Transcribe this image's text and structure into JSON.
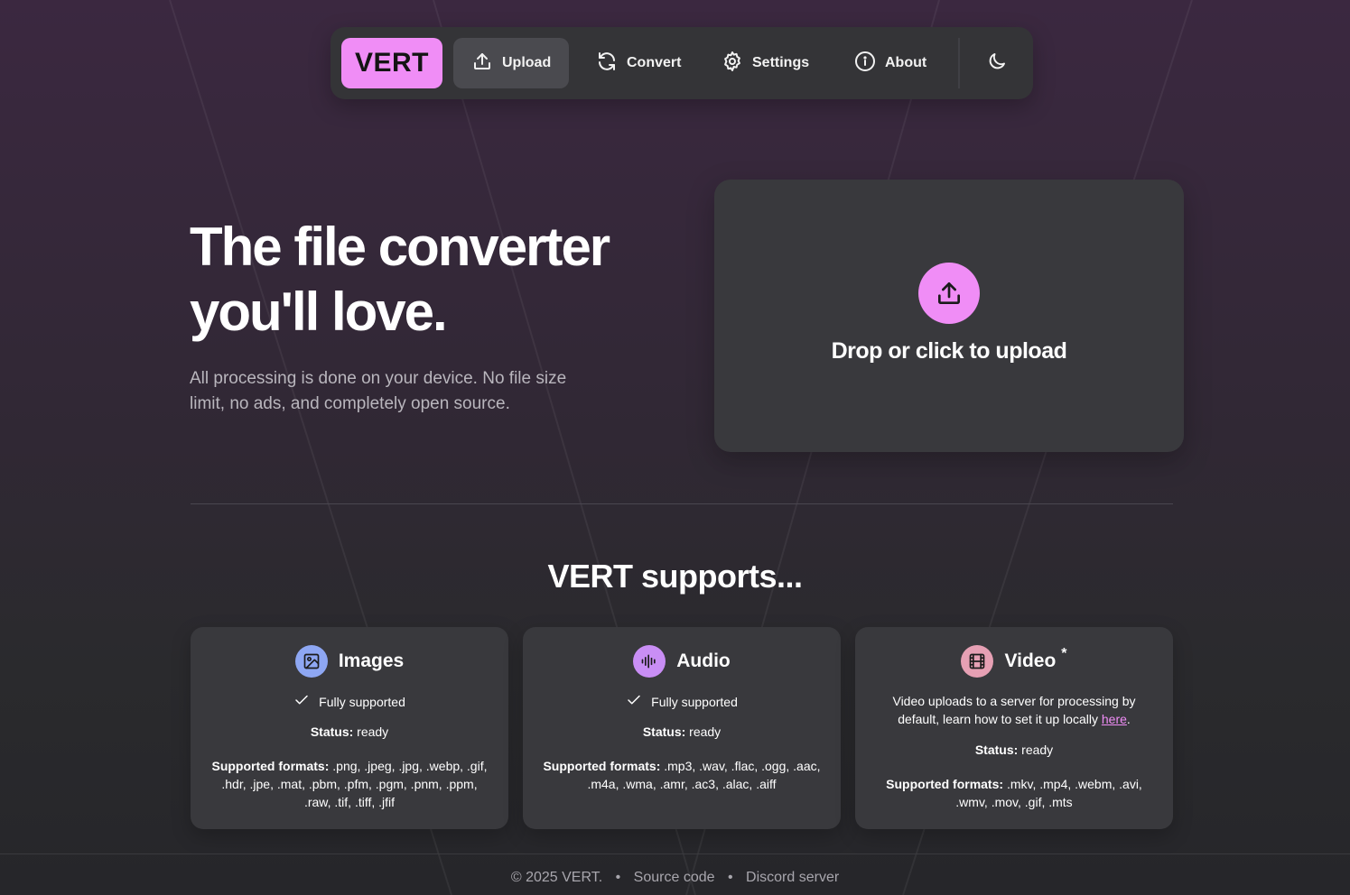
{
  "nav": {
    "logo": "VERT",
    "items": [
      {
        "label": "Upload",
        "icon": "upload-icon"
      },
      {
        "label": "Convert",
        "icon": "refresh-icon"
      },
      {
        "label": "Settings",
        "icon": "gear-icon"
      },
      {
        "label": "About",
        "icon": "info-icon"
      }
    ],
    "theme_icon": "moon-icon"
  },
  "hero": {
    "title_line1": "The file converter",
    "title_line2": "you'll love.",
    "sub_line1": "All processing is done on your device. No file size",
    "sub_line2": "limit, no ads, and completely open source."
  },
  "upload": {
    "label": "Drop or click to upload",
    "icon": "upload-icon"
  },
  "supports": {
    "title": "VERT supports...",
    "cards": [
      {
        "title": "Images",
        "icon": "image-icon",
        "icon_bg": "#8ea7f3",
        "support": "Fully supported",
        "status_label": "Status:",
        "status": "ready",
        "formats_label": "Supported formats:",
        "formats": ".png, .jpeg, .jpg, .webp, .gif, .hdr, .jpe, .mat, .pbm, .pfm, .pgm, .pnm, .ppm, .raw, .tif, .tiff, .jfif"
      },
      {
        "title": "Audio",
        "icon": "audio-waveform-icon",
        "icon_bg": "#c98ef5",
        "support": "Fully supported",
        "status_label": "Status:",
        "status": "ready",
        "formats_label": "Supported formats:",
        "formats": ".mp3, .wav, .flac, .ogg, .aac, .m4a, .wma, .amr, .ac3, .alac, .aiff"
      },
      {
        "title": "Video",
        "star": "*",
        "icon": "film-icon",
        "icon_bg": "#e6a0b4",
        "note_before": "Video uploads to a server for processing by default, learn how to set it up locally ",
        "note_link": "here",
        "note_after": ".",
        "status_label": "Status:",
        "status": "ready",
        "formats_label": "Supported formats:",
        "formats": ".mkv, .mp4, .webm, .avi, .wmv, .mov, .gif, .mts"
      }
    ]
  },
  "footer": {
    "copyright": "© 2025 VERT.",
    "separator": "•",
    "links": [
      "Source code",
      "Discord server"
    ]
  },
  "colors": {
    "accent": "#f08df6",
    "card_bg": "#39393d",
    "nav_bg": "#343437"
  }
}
